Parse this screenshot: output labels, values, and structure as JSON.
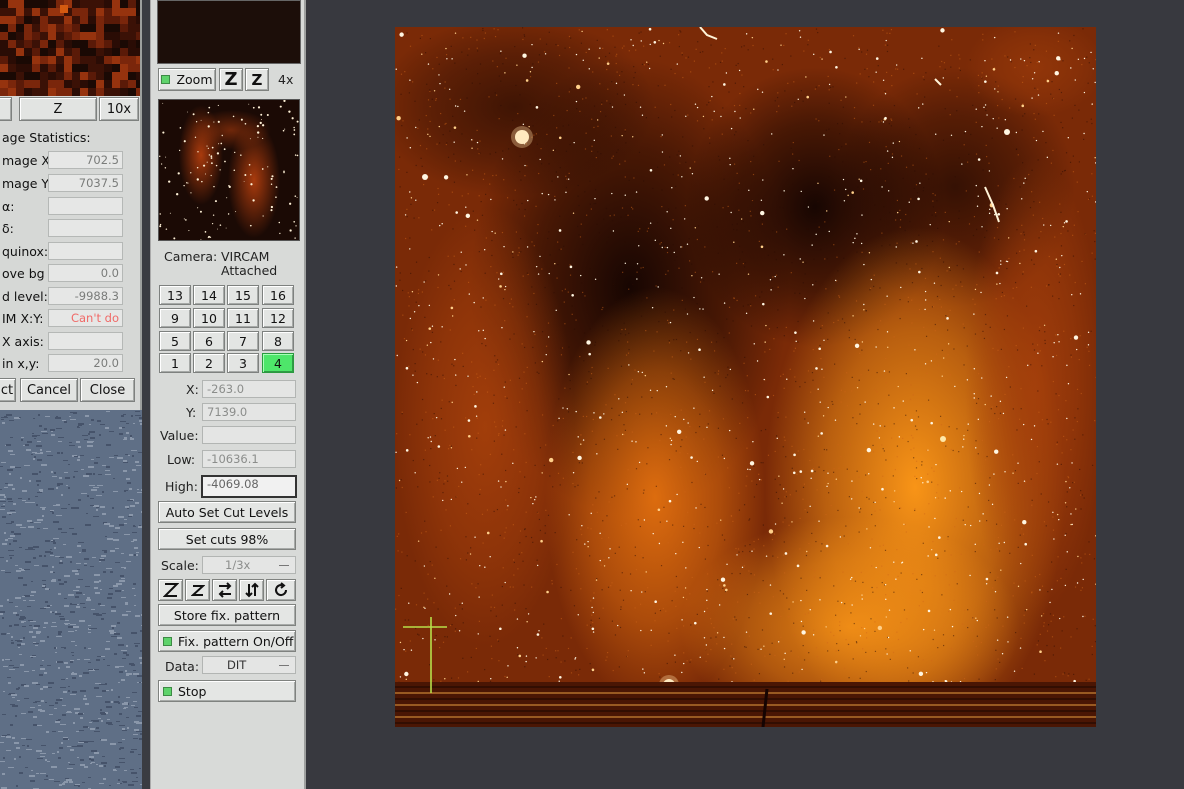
{
  "left_panel": {
    "zoom_z_label": "Z",
    "zoom_factor": "10x",
    "section_title": "age Statistics:",
    "rows": [
      {
        "label": "mage X:",
        "value": "702.5"
      },
      {
        "label": "mage Y:",
        "value": "7037.5"
      },
      {
        "label": "α:",
        "value": ""
      },
      {
        "label": "δ:",
        "value": ""
      },
      {
        "label": "quinox:",
        "value": ""
      },
      {
        "label": "ove bg",
        "value": "0.0"
      },
      {
        "label": "d level:",
        "value": "-9988.3"
      },
      {
        "label": "IM X:Y:",
        "value": "Can't do",
        "status_color": "#f06a68"
      },
      {
        "label": "X axis:",
        "value": ""
      },
      {
        "label": "in x,y:",
        "value": "20.0"
      }
    ],
    "buttons": {
      "select": "ct",
      "cancel": "Cancel",
      "close": "Close"
    }
  },
  "control": {
    "zoom_label": "Zoom",
    "zoom_z_big": "Z",
    "zoom_z_small": "Z",
    "zoom_factor": "4x",
    "camera_label": "Camera:",
    "camera_name": "VIRCAM",
    "camera_state": "Attached",
    "chips": [
      [
        "13",
        "14",
        "15",
        "16"
      ],
      [
        "9",
        "10",
        "11",
        "12"
      ],
      [
        "5",
        "6",
        "7",
        "8"
      ],
      [
        "1",
        "2",
        "3",
        "4"
      ]
    ],
    "selected_chip": "4",
    "x_label": "X:",
    "x_value": "-263.0",
    "y_label": "Y:",
    "y_value": "7139.0",
    "value_label": "Value:",
    "value_value": "",
    "low_label": "Low:",
    "low_value": "-10636.1",
    "high_label": "High:",
    "high_value": "-4069.08",
    "auto_cut_label": "Auto Set Cut Levels",
    "set_cuts_label": "Set cuts 98%",
    "scale_label": "Scale:",
    "scale_value": "1/3x",
    "store_pattern_label": "Store fix. pattern",
    "pattern_toggle_label": "Fix. pattern On/Off",
    "data_label": "Data:",
    "data_value": "DIT",
    "stop_label": "Stop"
  },
  "colors": {
    "led_green": "#5ed36b",
    "selected_chip": "#4ee66a",
    "error_text": "#f06a68",
    "image_bright": "#ff9a18",
    "image_dark": "#1c0903",
    "crosshair": "#b7e04a"
  }
}
